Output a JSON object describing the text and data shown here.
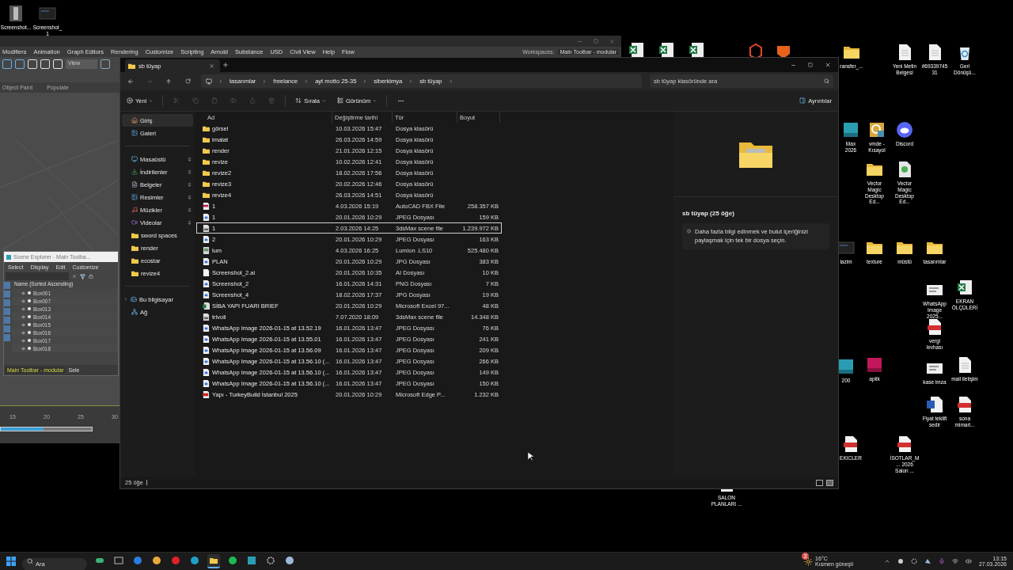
{
  "desktop_icons": [
    {
      "label": "Screenshot...",
      "kind": "thumb-tall"
    },
    {
      "label": "Screenshot_1",
      "kind": "thumb-dark"
    },
    {
      "kind": "excel"
    },
    {
      "kind": "excel"
    },
    {
      "kind": "excel"
    },
    {
      "kind": "app-red"
    },
    {
      "kind": "app-orange"
    },
    {
      "label": "ransfer_...",
      "kind": "folder"
    },
    {
      "label": "Yeni Metin Belgesi",
      "kind": "text-doc"
    },
    {
      "label": "#6933974531",
      "kind": "text-doc"
    },
    {
      "label": "Geri Dönüşü...",
      "kind": "recycle"
    },
    {
      "label": "Max 2026",
      "kind": "max"
    },
    {
      "label": "vmde - Kısayol",
      "kind": "shortcut"
    },
    {
      "label": "Discord",
      "kind": "discord"
    },
    {
      "label": "Vector Magic Desktop Ed...",
      "kind": "folder"
    },
    {
      "label": "Vector Magic Desktop Ed...",
      "kind": "torrent"
    },
    {
      "label": "lazim",
      "kind": "thumb-dark"
    },
    {
      "label": "texture",
      "kind": "folder"
    },
    {
      "label": "müstü",
      "kind": "folder"
    },
    {
      "label": "tasarımlar",
      "kind": "folder"
    },
    {
      "label": "WhatsApp Image 2025...",
      "kind": "thumb-light"
    },
    {
      "label": "EKRAN ÖLÇÜLERİ",
      "kind": "excel"
    },
    {
      "label": "vergi levhası",
      "kind": "pdf"
    },
    {
      "label": "200",
      "kind": "max"
    },
    {
      "label": "aplik",
      "kind": "fbx"
    },
    {
      "label": "kase imza",
      "kind": "thumb-light"
    },
    {
      "label": "mail iletişim",
      "kind": "text-doc"
    },
    {
      "label": "Fiyat teklifi sedir",
      "kind": "word"
    },
    {
      "label": "sona mimarl...",
      "kind": "pdf"
    },
    {
      "label": "EKICLER",
      "kind": "pdf"
    },
    {
      "label": "İSOTLAR_M... 2026 Salon ...",
      "kind": "pdf"
    },
    {
      "label": "SALON PLANLARI ...",
      "kind": "text-doc"
    }
  ],
  "max_window": {
    "menu": [
      "Modifiers",
      "Animation",
      "Graph Editors",
      "Rendering",
      "Customize",
      "Scripting",
      "Arnold",
      "Substance",
      "USD",
      "Civil View",
      "Help",
      "Flow"
    ],
    "workspace_label": "Workspaces:",
    "workspace": "Main Toolbar - modular",
    "view_dropdown": "View",
    "ribbon_tabs": [
      "Object Paint",
      "Populate"
    ],
    "scene_explorer": {
      "title": "Scene Explorer - Main Toolba...",
      "menu": [
        "Select",
        "Display",
        "Edit",
        "Customize"
      ],
      "column": "Name (Sorted Ascending)",
      "objects": [
        "Box001",
        "Box007",
        "Box013",
        "Box014",
        "Box015",
        "Box016",
        "Box017",
        "Box018"
      ],
      "toolbar": "Main Toolbar - modular",
      "button": "Sele"
    },
    "timeline_ticks": [
      "15",
      "20",
      "25",
      "30"
    ],
    "time_slider": {
      "level": 0.47
    }
  },
  "explorer": {
    "tab": "sb tüyap",
    "breadcrumbs": [
      "tasarımlar",
      "freelance",
      "ayt motto 25-35",
      "siberkimya",
      "sb tüyap"
    ],
    "search": {
      "placeholder": "sb tüyap klasöründe ara"
    },
    "commands": {
      "new": "Yeni",
      "sort": "Sırala",
      "view": "Görünüm",
      "details": "Ayrıntılar"
    },
    "sidebar_groups": [
      {
        "items": [
          {
            "label": "Giriş",
            "kind": "home",
            "selected": true,
            "pinned": false,
            "expandable": false
          },
          {
            "label": "Galeri",
            "kind": "gallery",
            "selected": false,
            "pinned": false,
            "expandable": false
          }
        ]
      },
      {
        "items": [
          {
            "label": "Masaüstü",
            "kind": "desktop",
            "selected": false,
            "pinned": true,
            "expandable": false
          },
          {
            "label": "İndirilenler",
            "kind": "download",
            "selected": false,
            "pinned": true,
            "expandable": false
          },
          {
            "label": "Belgeler",
            "kind": "documents",
            "selected": false,
            "pinned": true,
            "expandable": false
          },
          {
            "label": "Resimler",
            "kind": "pictures",
            "selected": false,
            "pinned": true,
            "expandable": false
          },
          {
            "label": "Müzikler",
            "kind": "music",
            "selected": false,
            "pinned": true,
            "expandable": false
          },
          {
            "label": "Videolar",
            "kind": "videos",
            "selected": false,
            "pinned": true,
            "expandable": false
          },
          {
            "label": "sword spaces",
            "kind": "folder",
            "selected": false,
            "pinned": false,
            "expandable": false
          },
          {
            "label": "render",
            "kind": "folder",
            "selected": false,
            "pinned": false,
            "expandable": false
          },
          {
            "label": "ecostar",
            "kind": "folder",
            "selected": false,
            "pinned": false,
            "expandable": false
          },
          {
            "label": "revize4",
            "kind": "folder",
            "selected": false,
            "pinned": false,
            "expandable": false
          }
        ]
      },
      {
        "items": [
          {
            "label": "Bu bilgisayar",
            "kind": "computer",
            "selected": false,
            "pinned": false,
            "expandable": true
          },
          {
            "label": "Ağ",
            "kind": "network",
            "selected": false,
            "pinned": false,
            "expandable": false
          }
        ]
      }
    ],
    "columns": [
      "Ad",
      "Değiştirme tarihi",
      "Tür",
      "Boyut"
    ],
    "rows": [
      {
        "name": "görsel",
        "date": "10.03.2026 15:47",
        "type": "Dosya klasörü",
        "kind": "folder",
        "selected": false
      },
      {
        "name": "imalat",
        "date": "26.03.2026 14:59",
        "type": "Dosya klasörü",
        "kind": "folder",
        "selected": false
      },
      {
        "name": "render",
        "date": "21.01.2026 12:15",
        "type": "Dosya klasörü",
        "kind": "folder",
        "selected": false
      },
      {
        "name": "revize",
        "date": "10.02.2026 12:41",
        "type": "Dosya klasörü",
        "kind": "folder",
        "selected": false
      },
      {
        "name": "revize2",
        "date": "18.02.2026 17:56",
        "type": "Dosya klasörü",
        "kind": "folder",
        "selected": false
      },
      {
        "name": "revize3",
        "date": "20.02.2026 12:46",
        "type": "Dosya klasörü",
        "kind": "folder",
        "selected": false
      },
      {
        "name": "revize4",
        "date": "26.03.2026 14:51",
        "type": "Dosya klasörü",
        "kind": "folder",
        "selected": false
      },
      {
        "name": "1",
        "date": "4.03.2026 15:19",
        "type": "AutoCAD FBX File",
        "size": "258.357 KB",
        "kind": "fbx",
        "selected": false
      },
      {
        "name": "1",
        "date": "20.01.2026 10:29",
        "type": "JPEG Dosyası",
        "size": "159 KB",
        "kind": "image",
        "selected": false
      },
      {
        "name": "1",
        "date": "2.03.2026 14:25",
        "type": "3dsMax scene file",
        "size": "1.239.972 KB",
        "kind": "max",
        "selected": true
      },
      {
        "name": "2",
        "date": "20.01.2026 10:29",
        "type": "JPEG Dosyası",
        "size": "163 KB",
        "kind": "image",
        "selected": false
      },
      {
        "name": "lum",
        "date": "4.03.2026 16:25",
        "type": "Lumion .LS10",
        "size": "525.480 KB",
        "kind": "lumion",
        "selected": false
      },
      {
        "name": "PLAN",
        "date": "20.01.2026 10:29",
        "type": "JPG Dosyası",
        "size": "383 KB",
        "kind": "image",
        "selected": false
      },
      {
        "name": "Screenshot_2.ai",
        "date": "20.01.2026 10:35",
        "type": "AI Dosyası",
        "size": "10 KB",
        "kind": "blank",
        "selected": false
      },
      {
        "name": "Screenshot_2",
        "date": "16.01.2026 14:31",
        "type": "PNG Dosyası",
        "size": "7 KB",
        "kind": "image",
        "selected": false
      },
      {
        "name": "Screenshot_4",
        "date": "18.02.2026 17:37",
        "type": "JPG Dosyası",
        "size": "19 KB",
        "kind": "image",
        "selected": false
      },
      {
        "name": "SİBA YAPI FUARI BRIEF",
        "date": "20.01.2026 10:29",
        "type": "Microsoft Excel 97...",
        "size": "48 KB",
        "kind": "excel",
        "selected": false
      },
      {
        "name": "trivoli",
        "date": "7.07.2020 18:09",
        "type": "3dsMax scene file",
        "size": "14.348 KB",
        "kind": "max",
        "selected": false
      },
      {
        "name": "WhatsApp Image 2026-01-15 at 13.52.19",
        "date": "16.01.2026 13:47",
        "type": "JPEG Dosyası",
        "size": "76 KB",
        "kind": "image",
        "selected": false
      },
      {
        "name": "WhatsApp Image 2026-01-15 at 13.55.01",
        "date": "16.01.2026 13:47",
        "type": "JPEG Dosyası",
        "size": "241 KB",
        "kind": "image",
        "selected": false
      },
      {
        "name": "WhatsApp Image 2026-01-15 at 13.56.09",
        "date": "16.01.2026 13:47",
        "type": "JPEG Dosyası",
        "size": "209 KB",
        "kind": "image",
        "selected": false
      },
      {
        "name": "WhatsApp Image 2026-01-15 at 13.56.10 (...",
        "date": "16.01.2026 13:47",
        "type": "JPEG Dosyası",
        "size": "266 KB",
        "kind": "image",
        "selected": false
      },
      {
        "name": "WhatsApp Image 2026-01-15 at 13.56.10 (...",
        "date": "16.01.2026 13:47",
        "type": "JPEG Dosyası",
        "size": "149 KB",
        "kind": "image",
        "selected": false
      },
      {
        "name": "WhatsApp Image 2026-01-15 at 13.56.10 (...",
        "date": "16.01.2026 13:47",
        "type": "JPEG Dosyası",
        "size": "150 KB",
        "kind": "image",
        "selected": false
      },
      {
        "name": "Yapı - TurkeyBuild İstanbul 2025",
        "date": "20.01.2026 10:29",
        "type": "Microsoft Edge P...",
        "size": "1.232 KB",
        "kind": "pdf",
        "selected": false
      }
    ],
    "details": {
      "title": "sb tüyap (25 öğe)",
      "message": "Daha fazla bilgi edinmek ve bulut içeriğinizi paylaşmak için tek bir dosya seçin."
    },
    "status": "25 öğe"
  },
  "taskbar": {
    "search": {
      "placeholder": "Ara"
    },
    "apps": [
      {
        "kind": "copilot",
        "active": false
      },
      {
        "kind": "taskview",
        "active": false
      },
      {
        "kind": "mail",
        "active": false
      },
      {
        "kind": "chrome",
        "active": false
      },
      {
        "kind": "opera",
        "active": false
      },
      {
        "kind": "edge",
        "active": false
      },
      {
        "kind": "explorer",
        "active": true
      },
      {
        "kind": "spotify",
        "active": false
      },
      {
        "kind": "max",
        "active": false
      },
      {
        "kind": "gear",
        "active": false
      },
      {
        "kind": "steam",
        "active": false
      }
    ],
    "weather": {
      "temp": "16°C",
      "condition": "Kısmen güneşli",
      "badge": "2"
    },
    "time": "13:15",
    "date": "27.03.2026"
  }
}
